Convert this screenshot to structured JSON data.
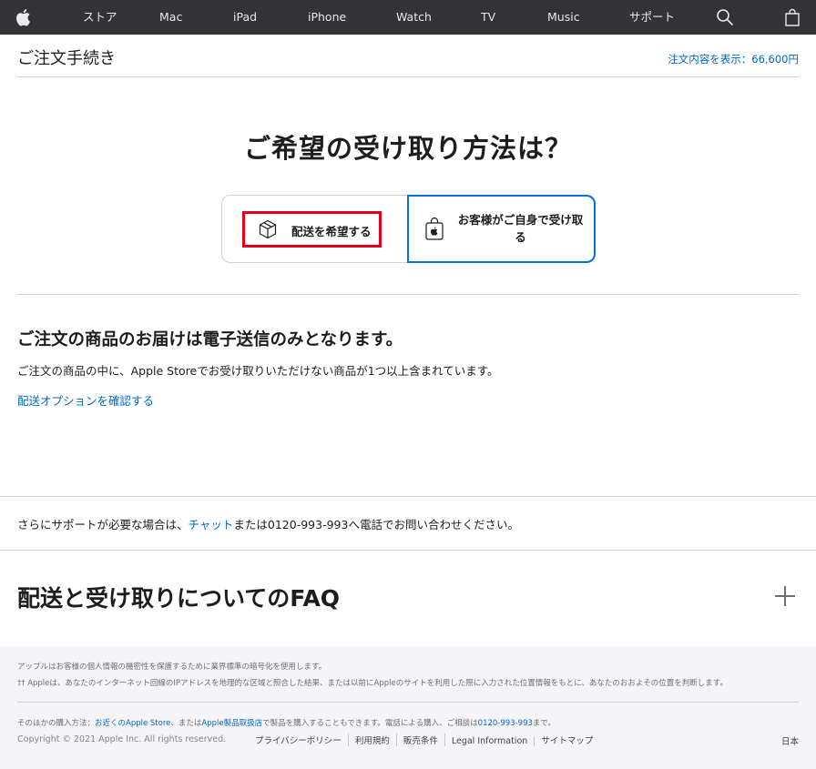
{
  "globalnav": {
    "apple_logo": "apple-logo",
    "items": [
      "ストア",
      "Mac",
      "iPad",
      "iPhone",
      "Watch",
      "TV",
      "Music",
      "サポート"
    ],
    "search_icon": "search-icon",
    "bag_icon": "bag-icon"
  },
  "checkout": {
    "title": "ご注文手続き",
    "order_summary": "注文内容を表示：66,600円"
  },
  "fulfillment": {
    "heading": "ご希望の受け取り方法は？",
    "ship_label": "配送を希望する",
    "pickup_label": "お客様がご自身で受け取る",
    "selected": "pickup",
    "highlight_color": "#e3001b"
  },
  "notice": {
    "heading": "ご注文の商品のお届けは電子送信のみとなります。",
    "body": "ご注文の商品の中に、Apple Storeでお受け取りいただけない商品が1つ以上含まれています。",
    "link": "配送オプションを確認する"
  },
  "support": {
    "prefix": "さらにサポートが必要な場合は、",
    "chat_link": "チャット",
    "suffix": "または0120-993-993へ電話でお問い合わせください。"
  },
  "faq": {
    "title": "配送と受け取りについてのFAQ",
    "expand_icon": "plus-icon"
  },
  "footer": {
    "privacy_note": "アップルはお客様の個人情報の機密性を保護するために業界標準の暗号化を使用します。",
    "location_note": "†† Appleは、あなたのインターネット回線のIPアドレスを地理的な区域と照合した結果、または以前にAppleのサイトを利用した際に入力された位置情報をもとに、あなたのおおよその位置を判断します。",
    "buy_prefix": "そのほかの購入方法：",
    "buy_store_link": "お近くのApple Store",
    "buy_mid": "、または",
    "buy_reseller_link": "Apple製品取扱店",
    "buy_mid2": "で製品を購入することもできます。電話による購入、ご相談は",
    "buy_phone": "0120-993-993",
    "buy_end": "まで。",
    "copyright": "Copyright © 2021 Apple Inc. All rights reserved.",
    "links": [
      "プライバシーポリシー",
      "利用規約",
      "販売条件",
      "Legal Information",
      "サイトマップ"
    ],
    "region": "日本"
  },
  "colors": {
    "nav_bg": "#333336",
    "link": "#0066cc",
    "selected_border": "#0071e3",
    "footer_bg": "#f5f5f7"
  }
}
